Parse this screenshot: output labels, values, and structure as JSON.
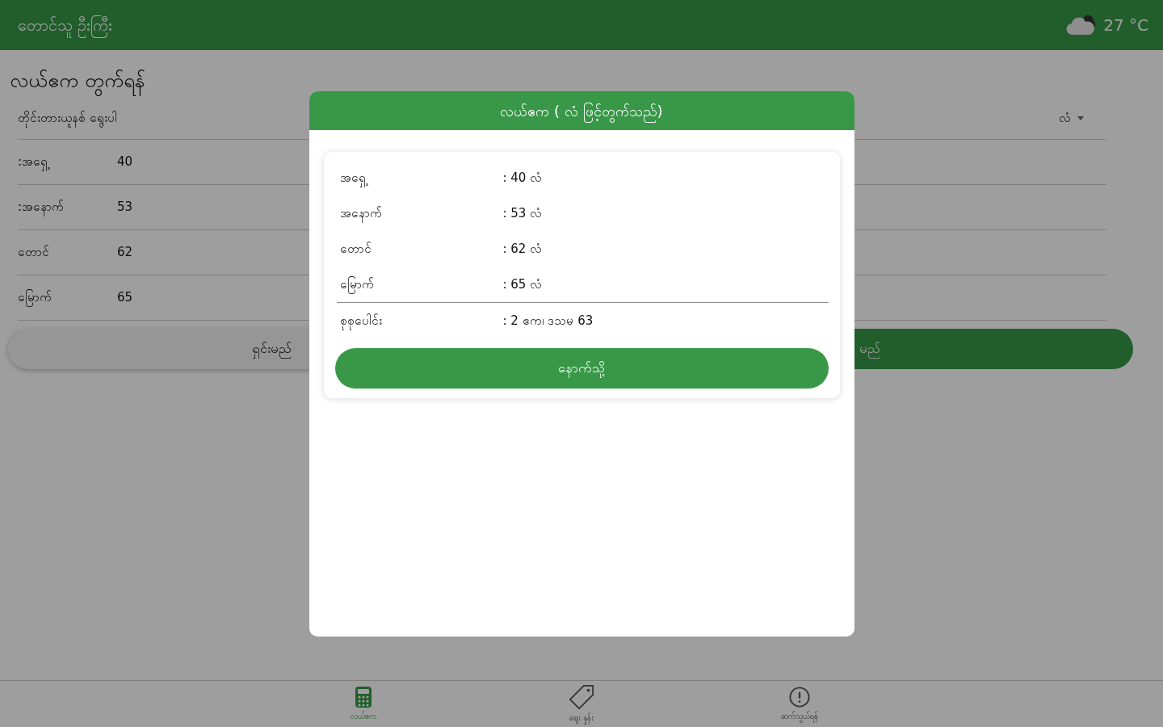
{
  "app_bar": {
    "title": "တောင်သူ ဦးကြီး",
    "temperature": "27 °C"
  },
  "page": {
    "title": "လယ်ဧက တွက်ရန်",
    "unit_label": "တိုင်းတားယူနစ် ရွေးပါ",
    "unit_select": {
      "value": "လံ"
    },
    "sides": [
      {
        "label": ":အရှေ့",
        "value": "40"
      },
      {
        "label": ":အနောက်",
        "value": "53"
      },
      {
        "label": "တောင်",
        "value": "62"
      },
      {
        "label": "မြောက်",
        "value": "65"
      }
    ],
    "buttons": [
      {
        "label": "ရှင်းမည်",
        "kind": "secondary"
      },
      {
        "label": "မည်",
        "kind": "primary"
      }
    ]
  },
  "dialog": {
    "title": "လယ်ဧက ( လံ ဖြင့်တွက်သည်)",
    "rows": [
      {
        "label": "အရှေ့",
        "value": ": 40 လံ"
      },
      {
        "label": "အနောက်",
        "value": ": 53 လံ"
      },
      {
        "label": "တောင်",
        "value": ": 62 လံ"
      },
      {
        "label": "မြောက်",
        "value": ": 65 လံ"
      }
    ],
    "total": {
      "label": "စုစုပေါင်း",
      "value": ": 2 ဧက၊ ဒသမ 63"
    },
    "button": "နောက်သို့"
  },
  "bottom_nav": [
    {
      "label": "လယ်ဧက",
      "selected": true
    },
    {
      "label": "ဈေး နှုန်း",
      "selected": false
    },
    {
      "label": "ဆက်သွယ်ရန်",
      "selected": false
    }
  ]
}
